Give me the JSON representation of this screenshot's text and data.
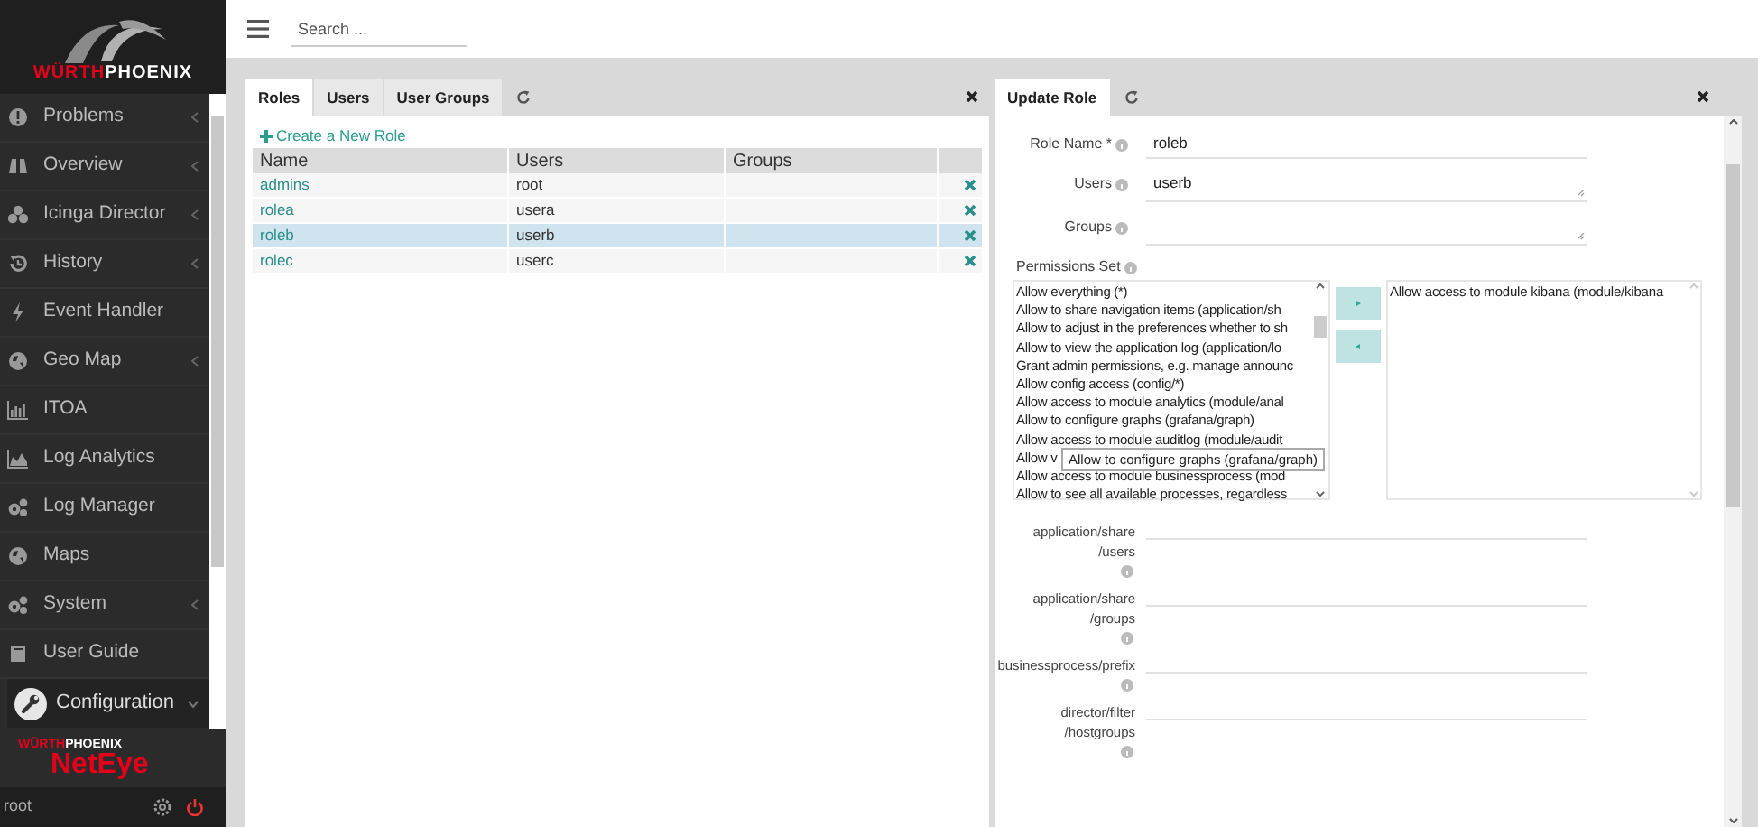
{
  "sidebar": {
    "logo": {
      "part_1": "WÜRTH",
      "part_2": "PHOENIX"
    },
    "items": [
      {
        "label": "Problems",
        "submenu": true,
        "selected": false
      },
      {
        "label": "Overview",
        "submenu": true,
        "selected": false
      },
      {
        "label": "Icinga Director",
        "submenu": true,
        "selected": false
      },
      {
        "label": "History",
        "submenu": true,
        "selected": false
      },
      {
        "label": "Event Handler",
        "submenu": false,
        "selected": false
      },
      {
        "label": "Geo Map",
        "submenu": true,
        "selected": false
      },
      {
        "label": "ITOA",
        "submenu": false,
        "selected": false
      },
      {
        "label": "Log Analytics",
        "submenu": false,
        "selected": false
      },
      {
        "label": "Log Manager",
        "submenu": false,
        "selected": false
      },
      {
        "label": "Maps",
        "submenu": false,
        "selected": false
      },
      {
        "label": "System",
        "submenu": true,
        "selected": false
      },
      {
        "label": "User Guide",
        "submenu": false,
        "selected": false
      },
      {
        "label": "Configuration",
        "submenu": true,
        "selected": true
      }
    ],
    "product": {
      "brand_1": "WÜRTH",
      "brand_2": "PHOENIX",
      "name": "NetEye"
    },
    "user": "root"
  },
  "search": {
    "placeholder": "Search ..."
  },
  "roles_panel": {
    "tabs": [
      {
        "label": "Roles",
        "selected": true
      },
      {
        "label": "Users",
        "selected": false
      },
      {
        "label": "User Groups",
        "selected": false
      }
    ],
    "create_link": "Create a New Role",
    "columns": [
      "Name",
      "Users",
      "Groups"
    ],
    "rows": [
      {
        "name": "admins",
        "users": "root",
        "selected": false
      },
      {
        "name": "rolea",
        "users": "usera",
        "selected": false
      },
      {
        "name": "roleb",
        "users": "userb",
        "selected": true
      },
      {
        "name": "rolec",
        "users": "userc",
        "selected": false
      }
    ]
  },
  "update_panel": {
    "tab": "Update Role",
    "fields": [
      {
        "label": "Role Name *",
        "value": "roleb",
        "kind": "input"
      },
      {
        "label": "Users",
        "value": "userb",
        "kind": "textarea"
      },
      {
        "label": "Groups",
        "kind": "textarea"
      }
    ],
    "permissions_label": "Permissions Set",
    "available": [
      "Allow everything (*)",
      "Allow to share navigation items (application/sh",
      "Allow to adjust in the preferences whether to sh",
      "Allow to view the application log (application/lo",
      "Grant admin permissions, e.g. manage announc",
      "Allow config access (config/*)",
      "Allow access to module analytics (module/anal",
      "Allow to configure graphs (grafana/graph)",
      "Allow access to module auditlog (module/audit",
      "Allow v",
      "Allow access to module businessprocess (mod",
      "Allow to see all available processes, regardless"
    ],
    "assigned": [
      "Allow access to module kibana (module/kibana"
    ],
    "tooltip": "Allow to configure graphs (grafana/graph)",
    "restrictions": [
      {
        "label_1": "application/share",
        "label_2": "/users"
      },
      {
        "label_1": "application/share",
        "label_2": "/groups"
      },
      {
        "label_1": "businessprocess/prefix"
      },
      {
        "label_1": "director/filter",
        "label_2": "/hostgroups"
      }
    ]
  }
}
